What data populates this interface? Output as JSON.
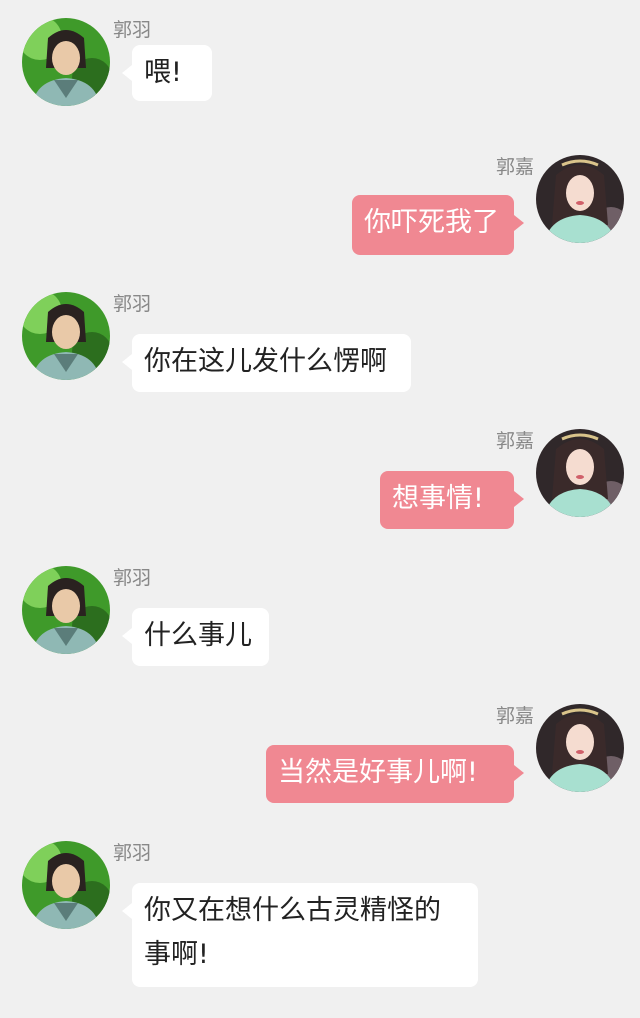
{
  "colors": {
    "background": "#f0f0f0",
    "bubble_left": "#ffffff",
    "bubble_right": "#f08892",
    "name_text": "#888888"
  },
  "messages": [
    {
      "side": "left",
      "sender": "郭羽",
      "text": "喂!",
      "avatar": "male-avatar-icon"
    },
    {
      "side": "right",
      "sender": "郭嘉",
      "text": "你吓死我了",
      "avatar": "female-avatar-icon"
    },
    {
      "side": "left",
      "sender": "郭羽",
      "text": "你在这儿发什么愣啊",
      "avatar": "male-avatar-icon"
    },
    {
      "side": "right",
      "sender": "郭嘉",
      "text": "想事情!",
      "avatar": "female-avatar-icon"
    },
    {
      "side": "left",
      "sender": "郭羽",
      "text": "什么事儿",
      "avatar": "male-avatar-icon"
    },
    {
      "side": "right",
      "sender": "郭嘉",
      "text": "当然是好事儿啊!",
      "avatar": "female-avatar-icon"
    },
    {
      "side": "left",
      "sender": "郭羽",
      "text": "你又在想什么古灵精怪的事啊!",
      "avatar": "male-avatar-icon"
    }
  ]
}
